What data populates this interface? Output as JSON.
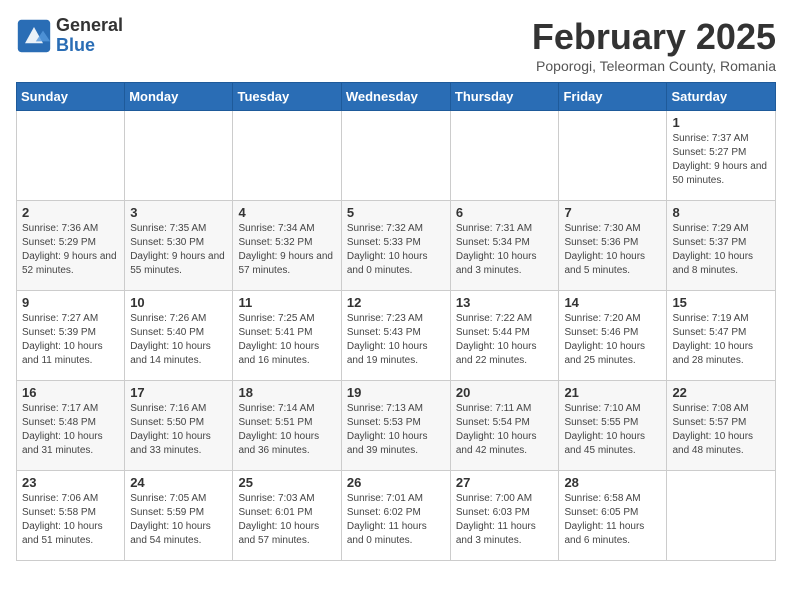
{
  "header": {
    "logo_general": "General",
    "logo_blue": "Blue",
    "month_title": "February 2025",
    "location": "Poporogi, Teleorman County, Romania"
  },
  "days_of_week": [
    "Sunday",
    "Monday",
    "Tuesday",
    "Wednesday",
    "Thursday",
    "Friday",
    "Saturday"
  ],
  "weeks": [
    {
      "cells": [
        {
          "day": "",
          "info": ""
        },
        {
          "day": "",
          "info": ""
        },
        {
          "day": "",
          "info": ""
        },
        {
          "day": "",
          "info": ""
        },
        {
          "day": "",
          "info": ""
        },
        {
          "day": "",
          "info": ""
        },
        {
          "day": "1",
          "info": "Sunrise: 7:37 AM\nSunset: 5:27 PM\nDaylight: 9 hours and 50 minutes."
        }
      ]
    },
    {
      "cells": [
        {
          "day": "2",
          "info": "Sunrise: 7:36 AM\nSunset: 5:29 PM\nDaylight: 9 hours and 52 minutes."
        },
        {
          "day": "3",
          "info": "Sunrise: 7:35 AM\nSunset: 5:30 PM\nDaylight: 9 hours and 55 minutes."
        },
        {
          "day": "4",
          "info": "Sunrise: 7:34 AM\nSunset: 5:32 PM\nDaylight: 9 hours and 57 minutes."
        },
        {
          "day": "5",
          "info": "Sunrise: 7:32 AM\nSunset: 5:33 PM\nDaylight: 10 hours and 0 minutes."
        },
        {
          "day": "6",
          "info": "Sunrise: 7:31 AM\nSunset: 5:34 PM\nDaylight: 10 hours and 3 minutes."
        },
        {
          "day": "7",
          "info": "Sunrise: 7:30 AM\nSunset: 5:36 PM\nDaylight: 10 hours and 5 minutes."
        },
        {
          "day": "8",
          "info": "Sunrise: 7:29 AM\nSunset: 5:37 PM\nDaylight: 10 hours and 8 minutes."
        }
      ]
    },
    {
      "cells": [
        {
          "day": "9",
          "info": "Sunrise: 7:27 AM\nSunset: 5:39 PM\nDaylight: 10 hours and 11 minutes."
        },
        {
          "day": "10",
          "info": "Sunrise: 7:26 AM\nSunset: 5:40 PM\nDaylight: 10 hours and 14 minutes."
        },
        {
          "day": "11",
          "info": "Sunrise: 7:25 AM\nSunset: 5:41 PM\nDaylight: 10 hours and 16 minutes."
        },
        {
          "day": "12",
          "info": "Sunrise: 7:23 AM\nSunset: 5:43 PM\nDaylight: 10 hours and 19 minutes."
        },
        {
          "day": "13",
          "info": "Sunrise: 7:22 AM\nSunset: 5:44 PM\nDaylight: 10 hours and 22 minutes."
        },
        {
          "day": "14",
          "info": "Sunrise: 7:20 AM\nSunset: 5:46 PM\nDaylight: 10 hours and 25 minutes."
        },
        {
          "day": "15",
          "info": "Sunrise: 7:19 AM\nSunset: 5:47 PM\nDaylight: 10 hours and 28 minutes."
        }
      ]
    },
    {
      "cells": [
        {
          "day": "16",
          "info": "Sunrise: 7:17 AM\nSunset: 5:48 PM\nDaylight: 10 hours and 31 minutes."
        },
        {
          "day": "17",
          "info": "Sunrise: 7:16 AM\nSunset: 5:50 PM\nDaylight: 10 hours and 33 minutes."
        },
        {
          "day": "18",
          "info": "Sunrise: 7:14 AM\nSunset: 5:51 PM\nDaylight: 10 hours and 36 minutes."
        },
        {
          "day": "19",
          "info": "Sunrise: 7:13 AM\nSunset: 5:53 PM\nDaylight: 10 hours and 39 minutes."
        },
        {
          "day": "20",
          "info": "Sunrise: 7:11 AM\nSunset: 5:54 PM\nDaylight: 10 hours and 42 minutes."
        },
        {
          "day": "21",
          "info": "Sunrise: 7:10 AM\nSunset: 5:55 PM\nDaylight: 10 hours and 45 minutes."
        },
        {
          "day": "22",
          "info": "Sunrise: 7:08 AM\nSunset: 5:57 PM\nDaylight: 10 hours and 48 minutes."
        }
      ]
    },
    {
      "cells": [
        {
          "day": "23",
          "info": "Sunrise: 7:06 AM\nSunset: 5:58 PM\nDaylight: 10 hours and 51 minutes."
        },
        {
          "day": "24",
          "info": "Sunrise: 7:05 AM\nSunset: 5:59 PM\nDaylight: 10 hours and 54 minutes."
        },
        {
          "day": "25",
          "info": "Sunrise: 7:03 AM\nSunset: 6:01 PM\nDaylight: 10 hours and 57 minutes."
        },
        {
          "day": "26",
          "info": "Sunrise: 7:01 AM\nSunset: 6:02 PM\nDaylight: 11 hours and 0 minutes."
        },
        {
          "day": "27",
          "info": "Sunrise: 7:00 AM\nSunset: 6:03 PM\nDaylight: 11 hours and 3 minutes."
        },
        {
          "day": "28",
          "info": "Sunrise: 6:58 AM\nSunset: 6:05 PM\nDaylight: 11 hours and 6 minutes."
        },
        {
          "day": "",
          "info": ""
        }
      ]
    }
  ]
}
